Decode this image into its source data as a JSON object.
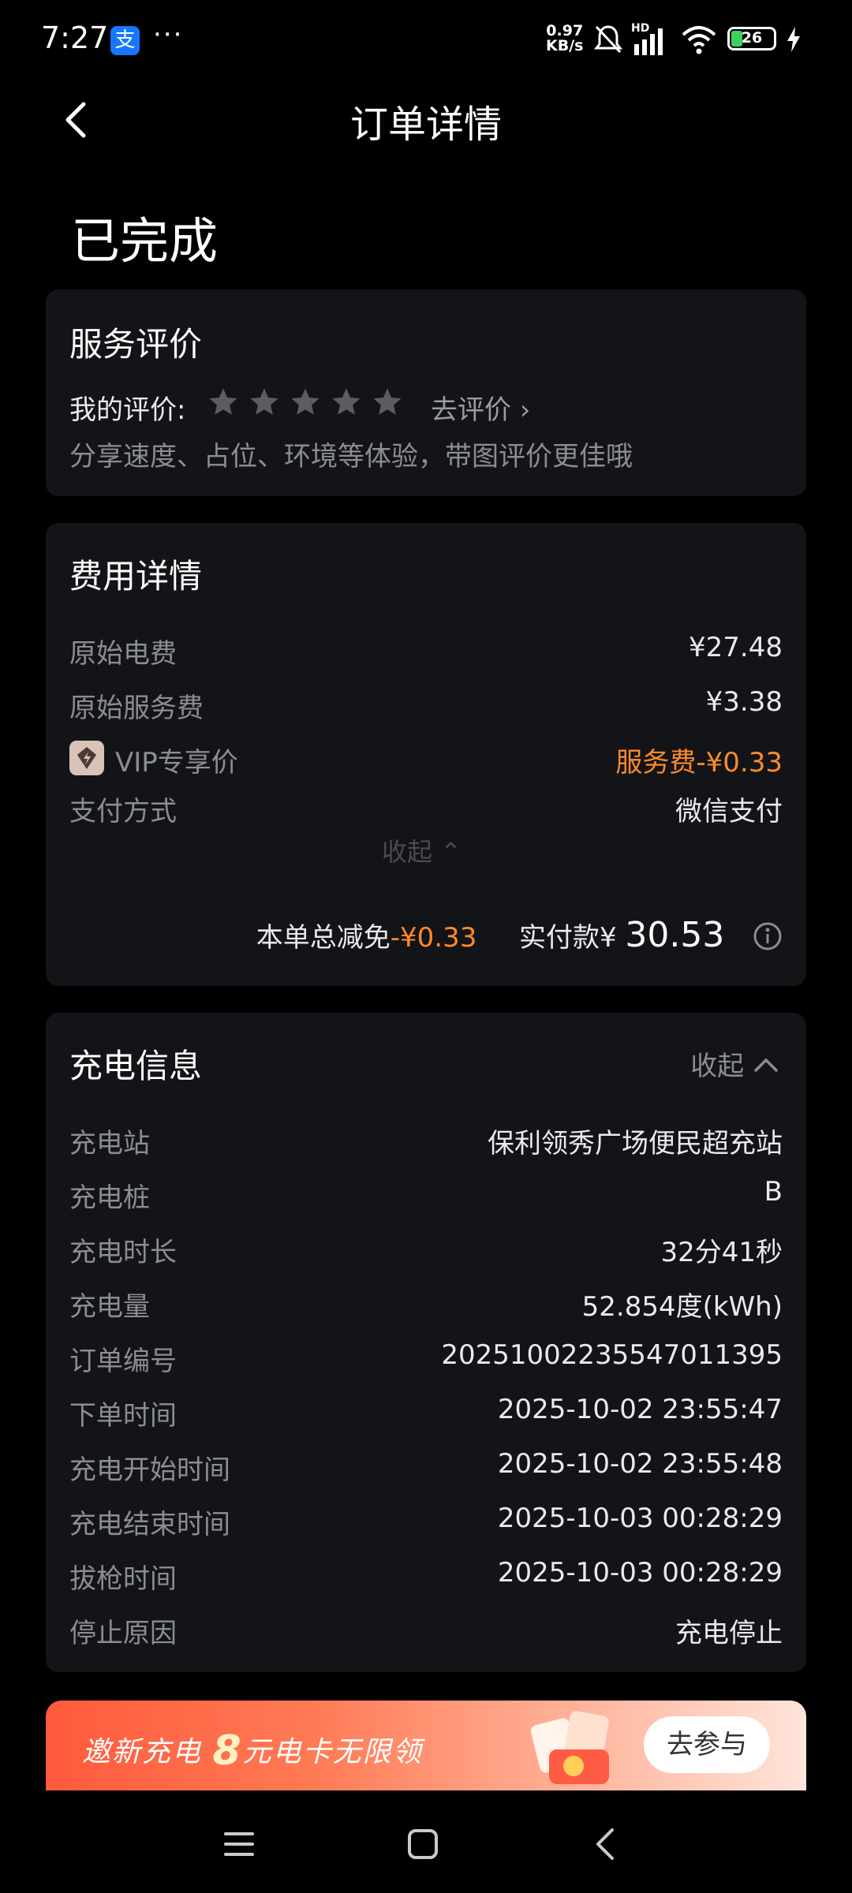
{
  "status_bar": {
    "time": "7:27",
    "app_icon_glyph": "支",
    "more": "···",
    "net_speed_value": "0.97",
    "net_speed_unit": "KB/s",
    "network": "HD",
    "battery": "26"
  },
  "nav": {
    "title": "订单详情"
  },
  "order_status": "已完成",
  "rating": {
    "title": "服务评价",
    "my_rating_label": "我的评价:",
    "stars": 0,
    "go_rate": "去评价 ›",
    "hint": "分享速度、占位、环境等体验，带图评价更佳哦"
  },
  "fees": {
    "title": "费用详情",
    "items": [
      {
        "label": "原始电费",
        "value": "¥27.48"
      },
      {
        "label": "原始服务费",
        "value": "¥3.38"
      },
      {
        "label": "VIP专享价",
        "value": "服务费-¥0.33"
      },
      {
        "label": "支付方式",
        "value": "微信支付"
      }
    ],
    "collapse": "收起 ⌃",
    "total_discount_label": "本单总减免",
    "total_discount_value": "-¥0.33",
    "paid_label": "实付款¥",
    "paid_value": "30.53"
  },
  "charging": {
    "title": "充电信息",
    "collapse": "收起",
    "items": [
      {
        "label": "充电站",
        "value": "保利领秀广场便民超充站"
      },
      {
        "label": "充电桩",
        "value": "B"
      },
      {
        "label": "充电时长",
        "value": "32分41秒"
      },
      {
        "label": "充电量",
        "value": "52.854度(kWh)"
      },
      {
        "label": "订单编号",
        "value": "20251002235547011395"
      },
      {
        "label": "下单时间",
        "value": "2025-10-02 23:55:47"
      },
      {
        "label": "充电开始时间",
        "value": "2025-10-02 23:55:48"
      },
      {
        "label": "充电结束时间",
        "value": "2025-10-03 00:28:29"
      },
      {
        "label": "拔枪时间",
        "value": "2025-10-03 00:28:29"
      },
      {
        "label": "停止原因",
        "value": "充电停止"
      }
    ]
  },
  "banner": {
    "text_before": "邀新充电 ",
    "big": "8",
    "text_after": "元电卡无限领",
    "button": "去参与"
  },
  "colors": {
    "background": "#000000",
    "card": "#131417",
    "accent_orange": "#ff8a2a",
    "muted": "#8b8d94"
  }
}
